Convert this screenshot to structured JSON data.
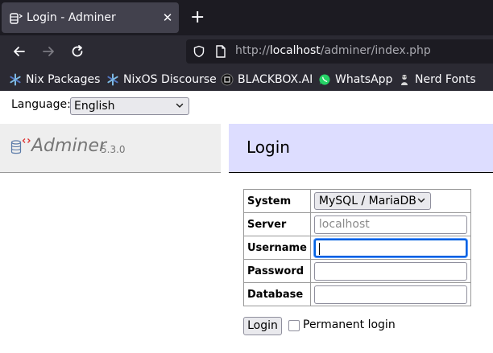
{
  "browser": {
    "tab": {
      "title": "Login - Adminer",
      "close_glyph": "✕"
    },
    "new_tab_glyph": "+",
    "url": {
      "scheme": "http://",
      "host": "localhost",
      "path": "/adminer/index.php"
    },
    "bookmarks": [
      {
        "label": "Nix Packages",
        "icon": "nix-snowflake-icon"
      },
      {
        "label": "NixOS Discourse",
        "icon": "nix-snowflake-icon"
      },
      {
        "label": "BLACKBOX.AI",
        "icon": "blackbox-icon"
      },
      {
        "label": "WhatsApp",
        "icon": "whatsapp-icon"
      },
      {
        "label": "Nerd Fonts",
        "icon": "nerd-fonts-icon"
      }
    ],
    "colors": {
      "tabbar": "#1c1b22",
      "toolbar": "#2b2a33",
      "tab_active": "#42414d"
    }
  },
  "language": {
    "label": "Language:",
    "selected": "English"
  },
  "app": {
    "name": "Adminer",
    "version": "5.3.0"
  },
  "main": {
    "title": "Login"
  },
  "form": {
    "system": {
      "label": "System",
      "selected": "MySQL / MariaDB"
    },
    "server": {
      "label": "Server",
      "placeholder": "localhost",
      "value": ""
    },
    "username": {
      "label": "Username",
      "value": ""
    },
    "password": {
      "label": "Password",
      "value": ""
    },
    "database": {
      "label": "Database",
      "value": ""
    },
    "submit_label": "Login",
    "permanent_label": "Permanent login",
    "permanent_checked": false
  },
  "colors": {
    "header_bg": "#ddddff",
    "sidebar_bg": "#eeeeee",
    "focus": "#0060df"
  }
}
